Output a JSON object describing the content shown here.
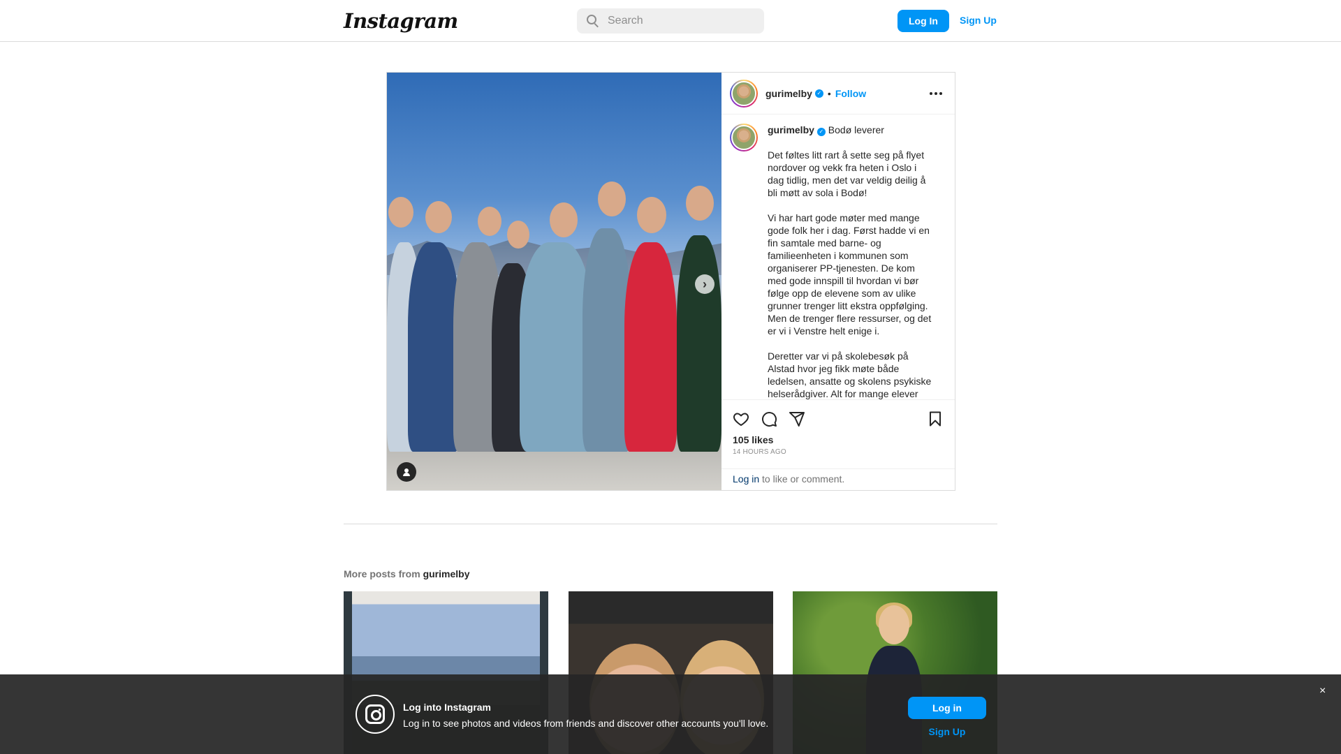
{
  "nav": {
    "logo": "Instagram",
    "search_placeholder": "Search",
    "login_label": "Log In",
    "signup_label": "Sign Up"
  },
  "post": {
    "username": "gurimelby",
    "verified_mark": "✓",
    "separator": "•",
    "follow_label": "Follow",
    "caption_title": "Bodø leverer",
    "caption_paragraphs": [
      "Det føltes litt rart å sette seg på flyet nordover og vekk fra heten i Oslo i dag tidlig, men det var veldig deilig å bli møtt av sola i Bodø!",
      "Vi har hart gode møter med mange gode folk her i dag. Først hadde vi en fin samtale med barne- og familieenheten i kommunen som organiserer PP-tjenesten. De kom med gode innspill til hvordan vi bør følge opp de elevene som av ulike grunner trenger litt ekstra oppfølging. Men de trenger flere ressurser, og det er vi i Venstre helt enige i.",
      "Deretter var vi på skolebesøk på Alstad hvor jeg fikk møte både ledelsen, ansatte og skolens psykiske helserådgiver. Alt for mange elever"
    ],
    "likes": "105 likes",
    "time_ago": "14 HOURS AGO",
    "login_link": "Log in",
    "login_suffix": " to like or comment.",
    "carousel_next": "›"
  },
  "more_posts": {
    "prefix": "More posts from ",
    "username": "gurimelby"
  },
  "banner": {
    "title": "Log into Instagram",
    "text": "Log in to see photos and videos from friends and discover other accounts you'll love.",
    "login_label": "Log in",
    "signup_label": "Sign Up",
    "close": "×"
  },
  "colors": {
    "accent": "#0095f6",
    "text": "#262626",
    "muted": "#8e8e8e",
    "banner_bg": "#262626"
  }
}
